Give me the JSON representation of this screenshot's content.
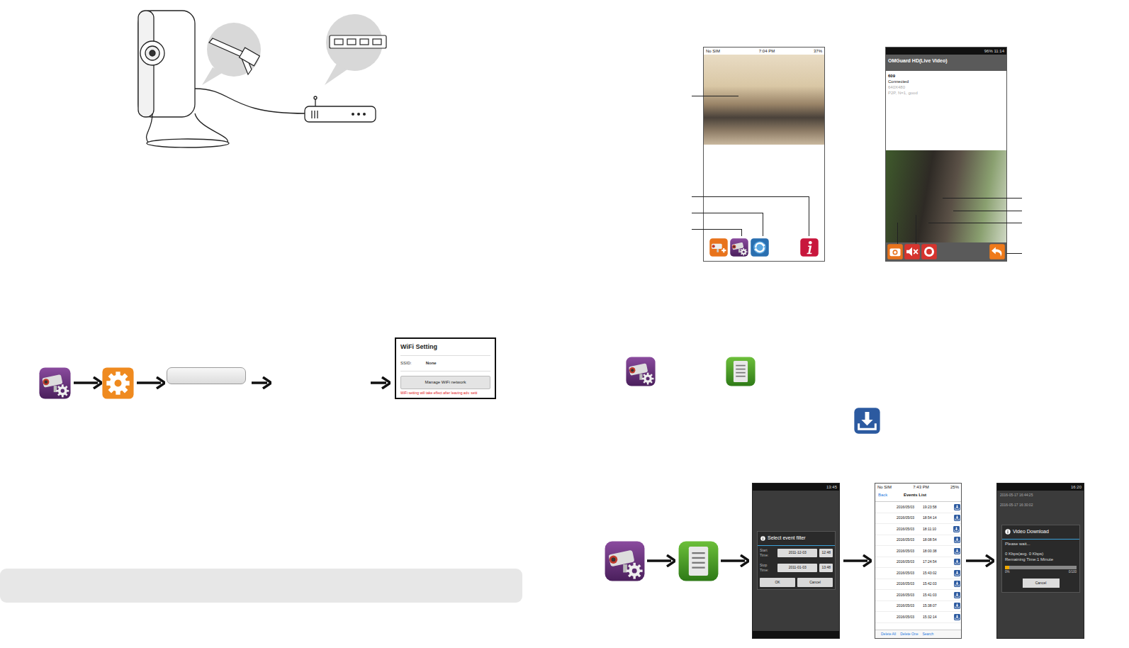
{
  "wifi_flow": {
    "setting_box": {
      "title": "WiFi Setting",
      "ssid_label": "SSID:",
      "ssid_value": "None",
      "button": "Manage WiFi network",
      "note": "WiFi setting will take effect after leaving adv. setti"
    }
  },
  "live_view_ios": {
    "status_bar": {
      "carrier": "No SIM",
      "time": "7:04 PM",
      "battery": "37%"
    }
  },
  "live_view_android": {
    "status_bar": {
      "battery": "96%",
      "time": "11:14"
    },
    "title": "OMGuard HD(Live Video)",
    "device": "609",
    "state": "Connected",
    "resolution": "640X480",
    "link": "P2P, N=1, good"
  },
  "event_filter": {
    "status_time": "13:45",
    "title": "Select event filter",
    "start_label": "Start Time:",
    "start_date": "2011-12-03",
    "start_time": "12:48",
    "stop_label": "Stop Time:",
    "stop_date": "2011-01-03",
    "stop_time": "13:48",
    "buttons": [
      "OK",
      "Cancel"
    ]
  },
  "events_list": {
    "status_bar": {
      "carrier": "No SIM",
      "time": "7:43 PM",
      "battery": "25%"
    },
    "back": "Back",
    "title": "Events List",
    "rows": [
      {
        "date": "2016/05/03",
        "time": "19:23:58"
      },
      {
        "date": "2016/05/03",
        "time": "18:54:14"
      },
      {
        "date": "2016/05/03",
        "time": "18:11:10"
      },
      {
        "date": "2016/05/03",
        "time": "18:08:54"
      },
      {
        "date": "2016/05/03",
        "time": "18:00:38"
      },
      {
        "date": "2016/05/03",
        "time": "17:24:54"
      },
      {
        "date": "2016/05/03",
        "time": "15:43:02"
      },
      {
        "date": "2016/05/03",
        "time": "15:42:03"
      },
      {
        "date": "2016/05/03",
        "time": "15:41:03"
      },
      {
        "date": "2016/05/03",
        "time": "15:38:07"
      },
      {
        "date": "2016/05/03",
        "time": "15:32:14"
      }
    ],
    "actions": [
      "Delete All",
      "Delete One",
      "Search"
    ]
  },
  "video_download": {
    "status_time": "16:20",
    "background_rows": [
      "2016-05-17 16:44:25",
      "2016-05-17 16:30:02"
    ],
    "title": "Video Download",
    "message": "Please wait...",
    "rate": "0 Kbps(avg. 0 Kbps)",
    "remaining": "Remaining Time:1 Minute",
    "level": 0.06,
    "percent": "0%",
    "count": "0/100",
    "button": "Cancel"
  }
}
